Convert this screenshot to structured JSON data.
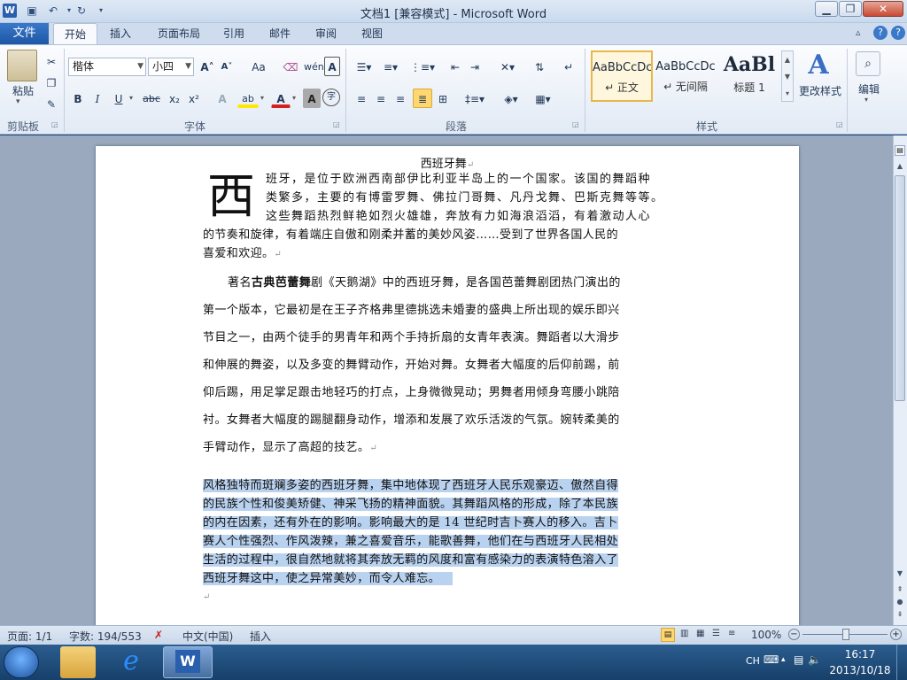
{
  "window": {
    "title": "文档1 [兼容模式] - Microsoft Word",
    "logo": "W",
    "minimize": "▁",
    "restore": "❐",
    "close": "✕"
  },
  "quick_access": {
    "save": "💾",
    "undo": "↶",
    "redo": "↻",
    "more": "▾"
  },
  "tabs": [
    "文件",
    "开始",
    "插入",
    "页面布局",
    "引用",
    "邮件",
    "审阅",
    "视图"
  ],
  "ribbon": {
    "clipboard": {
      "paste": "粘贴",
      "group": "剪贴板"
    },
    "font": {
      "name": "楷体",
      "size": "小四",
      "group": "字体",
      "bold": "B",
      "italic": "I",
      "underline": "U",
      "strike": "abc",
      "sub": "x₂",
      "sup": "x²",
      "grow": "A˄",
      "shrink": "A˅",
      "case": "Aa",
      "clear": "A",
      "text_effect": "A",
      "highlight": "ab",
      "font_color": "A",
      "char_shade": "A",
      "enclose": "字"
    },
    "paragraph": {
      "group": "段落"
    },
    "styles": {
      "group": "样式",
      "items": [
        {
          "sample": "AaBbCcDc",
          "name": "↵ 正文"
        },
        {
          "sample": "AaBbCcDc",
          "name": "↵ 无间隔"
        },
        {
          "sample": "AaBl",
          "name": "标题 1"
        }
      ],
      "change": "更改样式"
    },
    "editing": {
      "label": "编辑"
    }
  },
  "document": {
    "title": "西班牙舞",
    "dropcap": "西",
    "p1": [
      "班牙，是位于欧洲西南部伊比利亚半岛上的一个国家。该国的舞蹈种",
      "类繁多，主要的有博雷罗舞、佛拉门哥舞、凡丹戈舞、巴斯克舞等等。",
      "这些舞蹈热烈鲜艳如烈火雄雄，奔放有力如海浪滔滔，有着激动人心",
      "的节奏和旋律，有着端庄自傲和刚柔并蓄的美妙风姿……受到了世界各国人民的",
      "喜爱和欢迎。"
    ],
    "p2_pre": "著名",
    "p2_bold": "古典芭蕾舞",
    "p2_mid": "剧《天鹅湖》中的西班牙舞，是各国芭蕾舞剧团热门演出的",
    "p2_lines": [
      "第一个版本，它最初是在王子齐格弗里德挑选未婚妻的盛典上所出现的娱乐即兴",
      "节目之一，由两个徒手的男青年和两个手持折扇的女青年表演。舞蹈者以大滑步",
      "和伸展的舞姿，以及多变的舞臂动作，开始对舞。女舞者大幅度的后仰前踢，前",
      "仰后踢，用足掌足跟击地轻巧的打点，上身微微晃动；男舞者用倾身弯腰小跳陪",
      "衬。女舞者大幅度的踢腿翻身动作，增添和发展了欢乐活泼的气氛。婉转柔美的",
      "手臂动作，显示了高超的技艺。"
    ],
    "p3": [
      "风格独特而斑斓多姿的西班牙舞，集中地体现了西班牙人民乐观豪迈、傲然自得",
      "的民族个性和俊美矫健、神采飞扬的精神面貌。其舞蹈风格的形成，除了本民族",
      "的内在因素，还有外在的影响。影响最大的是 14 世纪时吉卜赛人的移入。吉卜",
      "赛人个性强烈、作风泼辣，兼之喜爱音乐，能歌善舞，他们在与西班牙人民相处",
      "生活的过程中，很自然地就将其奔放无羁的风度和富有感染力的表演特色溶入了",
      "西班牙舞这中，使之异常美妙，而令人难忘。"
    ],
    "para_mark": "↵"
  },
  "status": {
    "page": "页面: 1/1",
    "words": "字数: 194/553",
    "lang": "中文(中国)",
    "mode": "插入",
    "zoom": "100%"
  },
  "taskbar": {
    "lang": "CH",
    "time": "16:17",
    "date": "2013/10/18"
  }
}
